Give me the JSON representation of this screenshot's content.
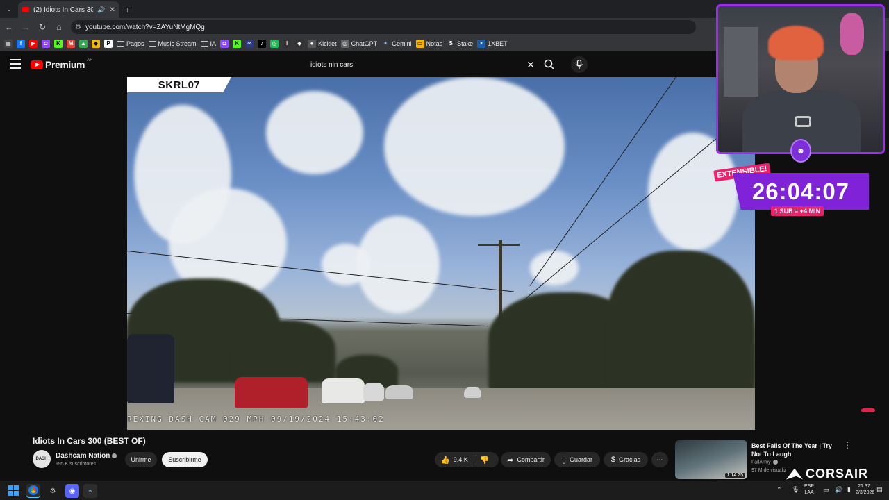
{
  "browser": {
    "tab_title": "(2) Idiots In Cars 300 (BEST",
    "url": "youtube.com/watch?v=ZAYuNtMgMQg",
    "bookmarks": [
      {
        "label": "Pagos",
        "kind": "folder"
      },
      {
        "label": "Music Stream",
        "kind": "folder"
      },
      {
        "label": "IA",
        "kind": "folder"
      },
      {
        "label": "Kicklet",
        "kind": "site"
      },
      {
        "label": "ChatGPT",
        "kind": "site"
      },
      {
        "label": "Gemini",
        "kind": "site"
      },
      {
        "label": "Notas",
        "kind": "site"
      },
      {
        "label": "Stake",
        "kind": "site"
      },
      {
        "label": "1XBET",
        "kind": "site"
      }
    ]
  },
  "youtube": {
    "logo_word": "Premium",
    "logo_country": "AR",
    "search_value": "idiots nin cars"
  },
  "video": {
    "plate_label": "SKRL07",
    "dashcam_stamp": "REXING DASH CAM 029 MPH 09/19/2024 15:43:02",
    "title": "Idiots In Cars 300 (BEST OF)",
    "channel": "Dashcam Nation",
    "subscribers": "195 K suscriptores",
    "join_label": "Unirme",
    "subscribe_label": "Suscribirme",
    "likes": "9,4 K",
    "share_label": "Compartir",
    "save_label": "Guardar",
    "thanks_label": "Gracias"
  },
  "stream_overlay": {
    "extensible_label": "EXTENSIBLE!",
    "timer": "26:04:07",
    "sub_rate": "1 SUB = +4 MIN",
    "sponsor": "CORSAIR"
  },
  "recommendation": {
    "title": "Best Fails Of The Year | Try Not To Laugh",
    "channel": "FailArmy",
    "views": "97 M de visualiz",
    "duration": "1:14:25"
  },
  "taskbar": {
    "lang_top": "ESP",
    "lang_bottom": "LAA",
    "time": "21:37",
    "date": "2/3/2026"
  }
}
